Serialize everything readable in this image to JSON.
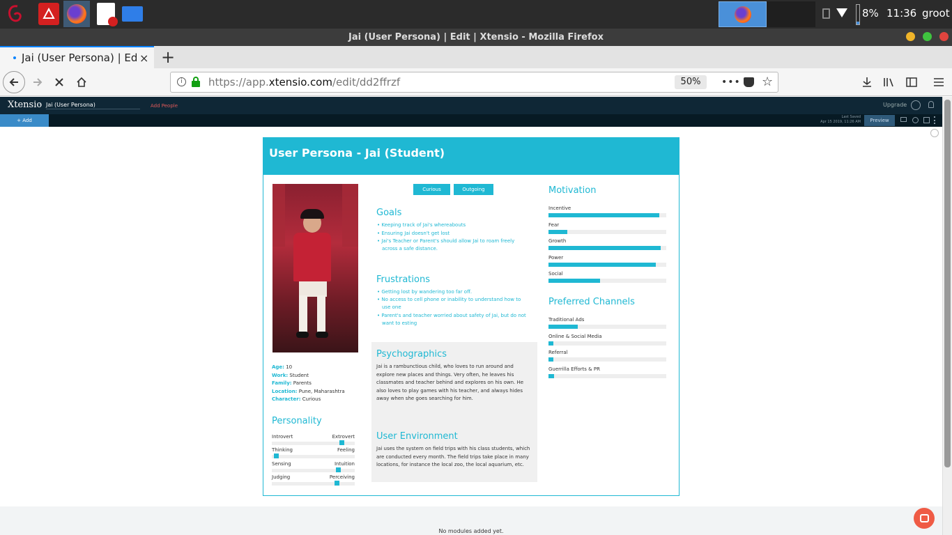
{
  "taskbar": {
    "battery": "8%",
    "time": "11:36",
    "user": "groot"
  },
  "window": {
    "title": "Jai (User Persona) | Edit | Xtensio - Mozilla Firefox"
  },
  "tab": {
    "title": "Jai (User Persona) | Edit | Xtensio",
    "close": "×",
    "new_tab": "+"
  },
  "navbar": {
    "url_prefix": "https://app.",
    "url_host": "xtensio.com",
    "url_path": "/edit/dd2ffrzf",
    "zoom": "50%"
  },
  "app": {
    "logo": "Xtensio",
    "doc_name": "Jai (User Persona)",
    "add_people": "Add People",
    "upgrade": "Upgrade",
    "add_label": "+ Add",
    "last_saved_label": "Last Saved",
    "last_saved_time": "Apr 15 2019, 11:26 AM",
    "preview": "Preview",
    "no_modules": "No modules added yet."
  },
  "persona": {
    "title": "User Persona - Jai (Student)",
    "tags": [
      "Curious",
      "Outgoing"
    ],
    "info": [
      {
        "label": "Age:",
        "value": "10"
      },
      {
        "label": "Work:",
        "value": "Student"
      },
      {
        "label": "Family:",
        "value": "Parents"
      },
      {
        "label": "Location:",
        "value": "Pune, Maharashtra"
      },
      {
        "label": "Character:",
        "value": "Curious"
      }
    ],
    "personality": {
      "title": "Personality",
      "sliders": [
        {
          "left": "Introvert",
          "right": "Extrovert",
          "value": 0.87
        },
        {
          "left": "Thinking",
          "right": "Feeling",
          "value": 0.03
        },
        {
          "left": "Sensing",
          "right": "Intuition",
          "value": 0.82
        },
        {
          "left": "Judging",
          "right": "Perceiving",
          "value": 0.8
        }
      ]
    },
    "goals": {
      "title": "Goals",
      "items": [
        "Keeping track of Jai's whereabouts",
        "Ensuring Jai doesn't get lost",
        "Jai's Teacher or Parent's should allow Jai to roam freely across a safe distance."
      ]
    },
    "frustrations": {
      "title": "Frustrations",
      "items": [
        "Getting lost by wandering too far off.",
        "No access to cell phone or inability to understand how to use one",
        "Parent's and teacher worried about safety of Jai, but do not want to esting"
      ]
    },
    "psychographics": {
      "title": "Psychographics",
      "text": "Jai is a rambunctious child, who loves to run around and explore new places and things. Very often, he leaves his classmates and teacher behind and explores on his own. He also loves to play games with his teacher, and always hides away when she goes searching for him."
    },
    "environment": {
      "title": "User Environment",
      "text": "Jai uses the system on field trips with his class students, which are conducted every month. The field trips take place in many locations, for instance the local zoo, the local aquarium, etc."
    },
    "motivation": {
      "title": "Motivation",
      "bars": [
        {
          "label": "Incentive",
          "value": 0.94
        },
        {
          "label": "Fear",
          "value": 0.16
        },
        {
          "label": "Growth",
          "value": 0.95
        },
        {
          "label": "Power",
          "value": 0.91
        },
        {
          "label": "Social",
          "value": 0.44
        }
      ]
    },
    "channels": {
      "title": "Preferred Channels",
      "bars": [
        {
          "label": "Traditional Ads",
          "value": 0.25
        },
        {
          "label": "Online & Social Media",
          "value": 0.04
        },
        {
          "label": "Referral",
          "value": 0.04
        },
        {
          "label": "Guerrilla Efforts & PR",
          "value": 0.05
        }
      ]
    }
  }
}
